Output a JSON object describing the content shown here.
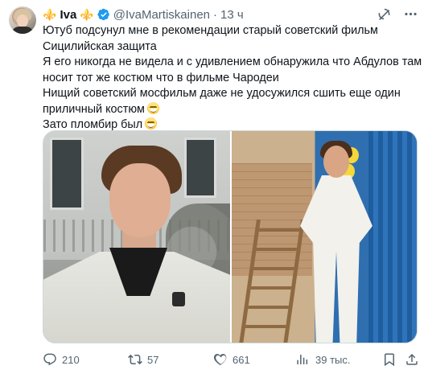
{
  "author": {
    "name": "Iva",
    "name_decoration": "⚜️",
    "handle": "@IvaMartiskainen",
    "separator": "·",
    "time": "13 ч"
  },
  "tweet": {
    "lines": [
      "Ютуб подсунул мне в рекомендации старый советский фильм",
      "Сицилийская защита",
      "Я его никогда не видела и с удивлением обнаружила что Абдулов там",
      "носит тот же костюм что в фильме Чародеи",
      "Нищий советский мосфильм даже не удосужился сшить еще один",
      "приличный костюм",
      "Зато пломбир был"
    ]
  },
  "actions": {
    "replies": "210",
    "retweets": "57",
    "likes": "661",
    "views": "39 тыс."
  },
  "icons": {
    "verified": "verified-badge-icon",
    "grok": "grok-icon",
    "more": "more-icon",
    "reply": "reply-icon",
    "retweet": "retweet-icon",
    "like": "heart-icon",
    "views": "views-icon",
    "bookmark": "bookmark-icon",
    "share": "share-icon"
  },
  "colors": {
    "accent": "#1d9bf0",
    "text": "#0f1419",
    "secondary": "#536471",
    "fleur": "#7b3fb8"
  }
}
